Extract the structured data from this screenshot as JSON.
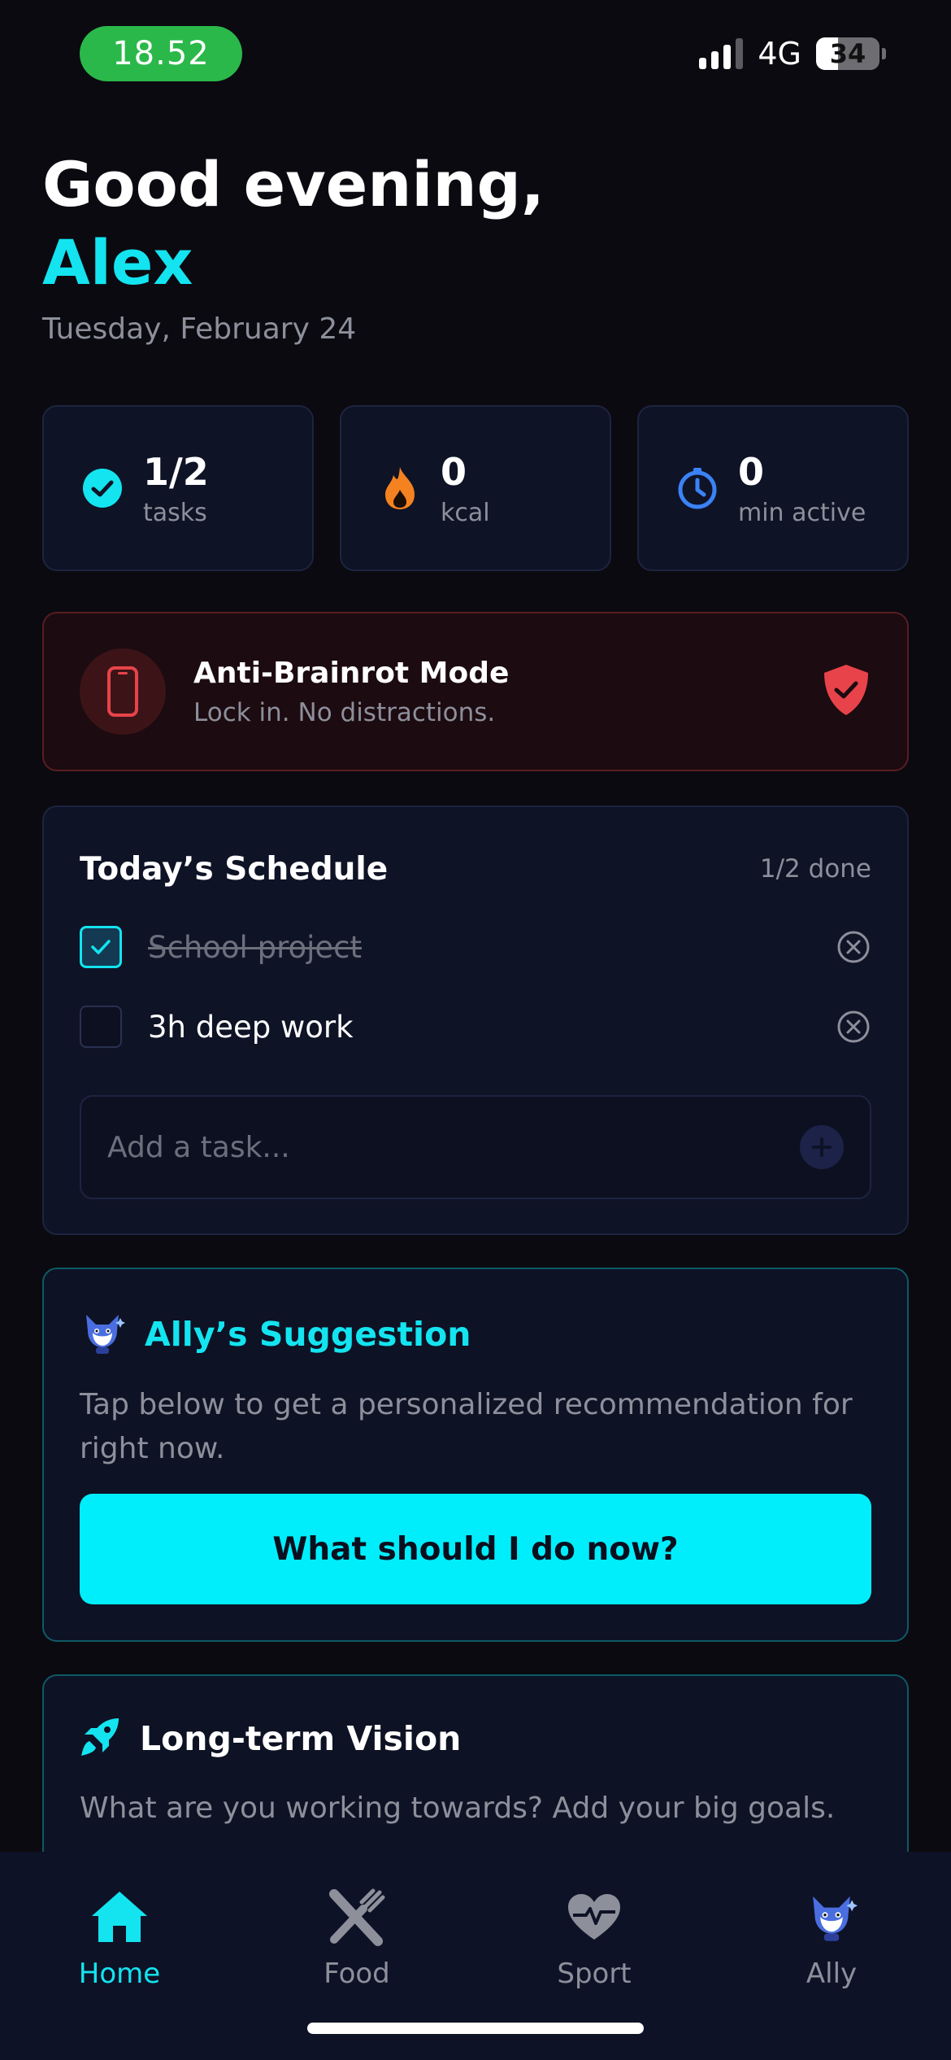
{
  "status_bar": {
    "time": "18.52",
    "network": "4G",
    "battery_percent": 34,
    "battery_label": "34"
  },
  "greeting": {
    "line": "Good evening,",
    "name": "Alex",
    "date": "Tuesday, February 24"
  },
  "stats": [
    {
      "value": "1/2",
      "label": "tasks",
      "icon": "check-circle-icon"
    },
    {
      "value": "0",
      "label": "kcal",
      "icon": "flame-icon"
    },
    {
      "value": "0",
      "label": "min active",
      "icon": "timer-icon"
    }
  ],
  "anti_brainrot": {
    "title": "Anti-Brainrot Mode",
    "subtitle": "Lock in. No distractions.",
    "icon": "phone-icon",
    "status_icon": "shield-check-icon"
  },
  "schedule": {
    "title": "Today’s Schedule",
    "count": "1/2 done",
    "tasks": [
      {
        "label": "School project",
        "done": true
      },
      {
        "label": "3h deep work",
        "done": false
      }
    ],
    "add_placeholder": "Add a task..."
  },
  "ally": {
    "title": "Ally’s Suggestion",
    "text": "Tap below to get a personalized recommendation for right now.",
    "button": "What should I do now?",
    "icon": "fox-mascot-icon"
  },
  "vision": {
    "title": "Long-term Vision",
    "text": "What are you working towards? Add your big goals.",
    "icon": "rocket-icon"
  },
  "tabs": [
    {
      "label": "Home",
      "icon": "home-icon",
      "active": true
    },
    {
      "label": "Food",
      "icon": "utensils-icon",
      "active": false
    },
    {
      "label": "Sport",
      "icon": "heart-pulse-icon",
      "active": false
    },
    {
      "label": "Ally",
      "icon": "fox-mascot-icon",
      "active": false
    }
  ],
  "colors": {
    "accent": "#13e4f0",
    "background": "#0a0a10",
    "card": "#0f1326",
    "danger": "#e8434a",
    "status_green": "#2bb84a"
  }
}
